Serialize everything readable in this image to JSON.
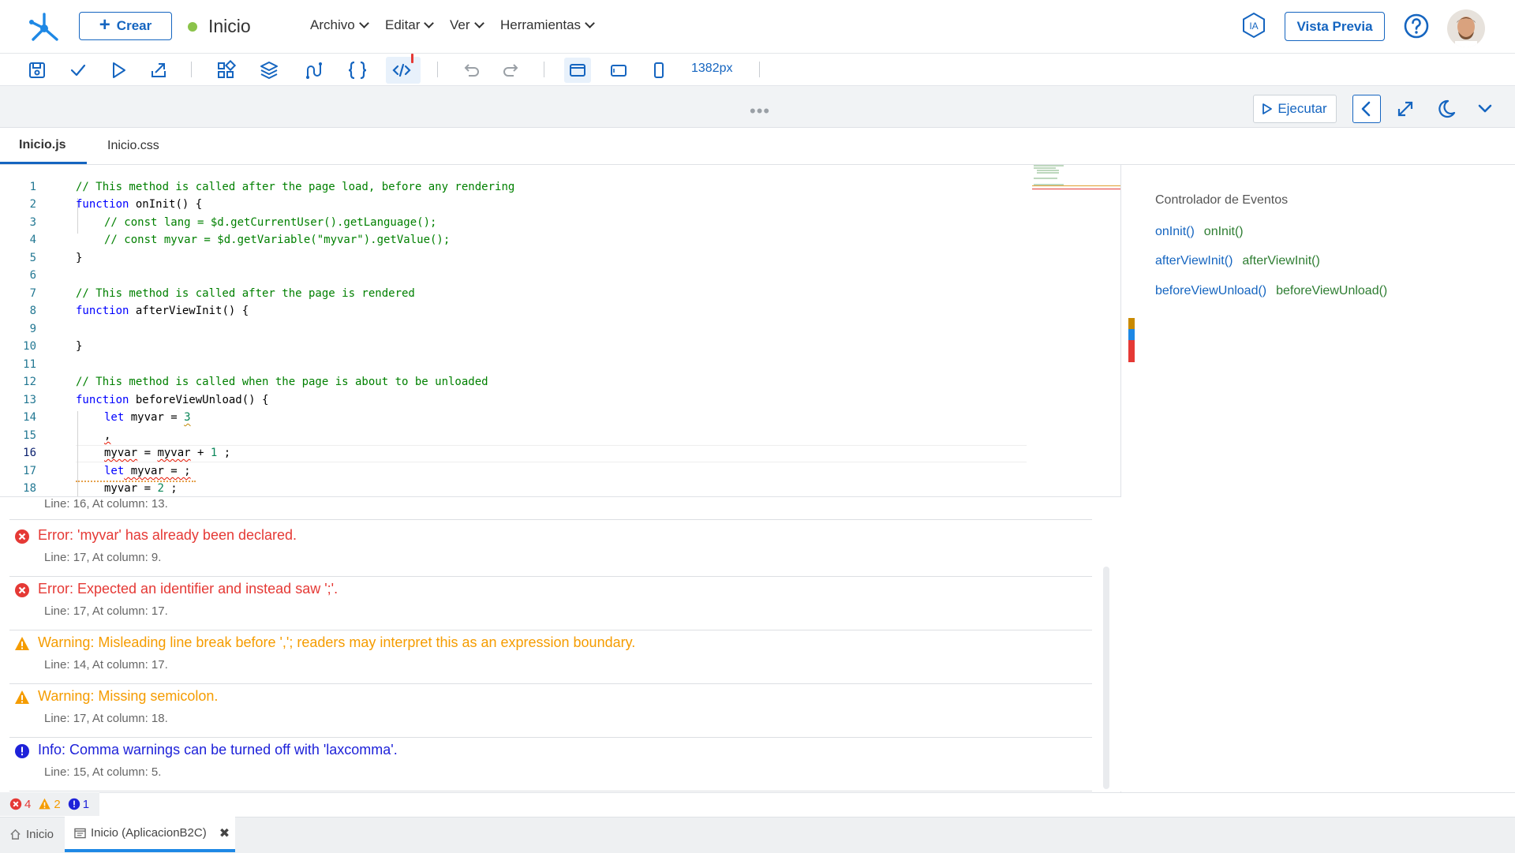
{
  "header": {
    "create_label": "Crear",
    "page_title": "Inicio",
    "menus": [
      "Archivo",
      "Editar",
      "Ver",
      "Herramientas"
    ],
    "ia_label": "IA",
    "preview_label": "Vista Previa"
  },
  "toolbar": {
    "icons": [
      "save-icon",
      "check-icon",
      "play-icon",
      "publish-icon",
      "components-icon",
      "layers-icon",
      "flow-icon",
      "braces-icon",
      "code-icon",
      "undo-icon",
      "redo-icon",
      "desktop-icon",
      "tablet-icon",
      "mobile-icon"
    ],
    "width_label": "1382px"
  },
  "actions": {
    "run_label": "Ejecutar"
  },
  "tabs": [
    {
      "label": "Inicio.js",
      "active": true
    },
    {
      "label": "Inicio.css",
      "active": false
    }
  ],
  "editor": {
    "line_numbers": [
      "1",
      "2",
      "3",
      "4",
      "5",
      "6",
      "7",
      "8",
      "9",
      "10",
      "11",
      "12",
      "13",
      "14",
      "15",
      "16",
      "17",
      "18"
    ],
    "lines": {
      "l1": "// This method is called after the page load, before any rendering",
      "l2_kw": "function",
      "l2_name": " onInit() {",
      "l3": "// const lang = $d.getCurrentUser().getLanguage();",
      "l4": "// const myvar = $d.getVariable(\"myvar\").getValue();",
      "l5": "}",
      "l7": "// This method is called after the page is rendered",
      "l8_kw": "function",
      "l8_name": " afterViewInit() {",
      "l10": "}",
      "l12": "// This method is called when the page is about to be unloaded",
      "l13_kw": "function",
      "l13_name": " beforeViewUnload() {",
      "l14_kw": "let",
      "l14_rest": " myvar = ",
      "l14_num": "3",
      "l15": ",",
      "l16_a": "myvar",
      "l16_b": " = ",
      "l16_c": "myvar",
      "l16_d": " + ",
      "l16_num": "1",
      "l16_e": " ;",
      "l17_kw": "let",
      "l17_rest": " myvar = ;",
      "l18_a": "myvar = ",
      "l18_num": "2",
      "l18_b": " ;"
    }
  },
  "events": {
    "title": "Controlador de Eventos",
    "items": [
      {
        "a": "onInit()",
        "b": "onInit()"
      },
      {
        "a": "afterViewInit()",
        "b": "afterViewInit()"
      },
      {
        "a": "beforeViewUnload()",
        "b": "beforeViewUnload()"
      }
    ]
  },
  "problems": {
    "first_location": "Line: 16, At column: 13.",
    "items": [
      {
        "level": "error",
        "message": "Error: 'myvar' has already been declared.",
        "location": "Line: 17, At column: 9."
      },
      {
        "level": "error",
        "message": "Error: Expected an identifier and instead saw ';'.",
        "location": "Line: 17, At column: 17."
      },
      {
        "level": "warning",
        "message": "Warning: Misleading line break before ','; readers may interpret this as an expression boundary.",
        "location": "Line: 14, At column: 17."
      },
      {
        "level": "warning",
        "message": "Warning: Missing semicolon.",
        "location": "Line: 17, At column: 18."
      },
      {
        "level": "info",
        "message": "Info: Comma warnings can be turned off with 'laxcomma'.",
        "location": "Line: 15, At column: 5."
      }
    ]
  },
  "status": {
    "errors": "4",
    "warnings": "2",
    "infos": "1"
  },
  "bottom_tabs": {
    "home_label": "Inicio",
    "editor_label": "Inicio (AplicacionB2C)"
  },
  "colors": {
    "accent": "#1565c0",
    "error": "#e53935",
    "warning": "#f59c00",
    "info": "#1e22d9",
    "status_dot": "#8bc34a"
  }
}
